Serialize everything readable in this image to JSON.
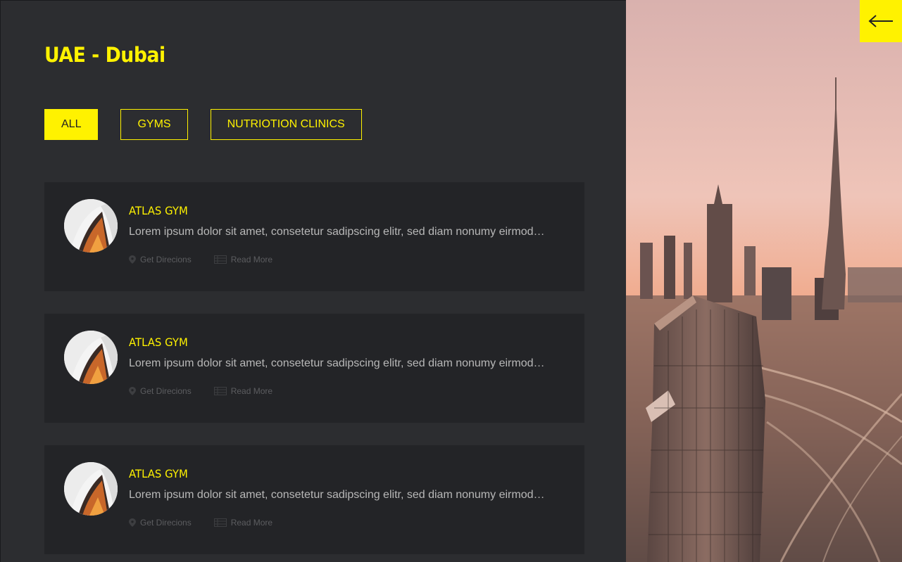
{
  "page": {
    "title": "UAE - Dubai"
  },
  "filters": [
    {
      "label": "ALL",
      "active": true
    },
    {
      "label": "GYMS",
      "active": false
    },
    {
      "label": "NUTRIOTION CLINICS",
      "active": false
    }
  ],
  "listings": [
    {
      "title": "ATLAS GYM",
      "description": "Lorem ipsum dolor sit amet, consetetur sadipscing elitr, sed diam nonumy eirmod…",
      "directions_label": "Get Direcions",
      "read_more_label": "Read More"
    },
    {
      "title": "ATLAS GYM",
      "description": "Lorem ipsum dolor sit amet, consetetur sadipscing elitr, sed diam nonumy eirmod…",
      "directions_label": "Get Direcions",
      "read_more_label": "Read More"
    },
    {
      "title": "ATLAS GYM",
      "description": "Lorem ipsum dolor sit amet, consetetur sadipscing elitr, sed diam nonumy eirmod…",
      "directions_label": "Get Direcions",
      "read_more_label": "Read More"
    }
  ],
  "icons": {
    "back": "arrow-left-icon",
    "directions": "map-pin-icon",
    "read_more": "list-icon"
  },
  "colors": {
    "accent": "#fff200",
    "background": "#2c2d30",
    "card": "#232427"
  }
}
